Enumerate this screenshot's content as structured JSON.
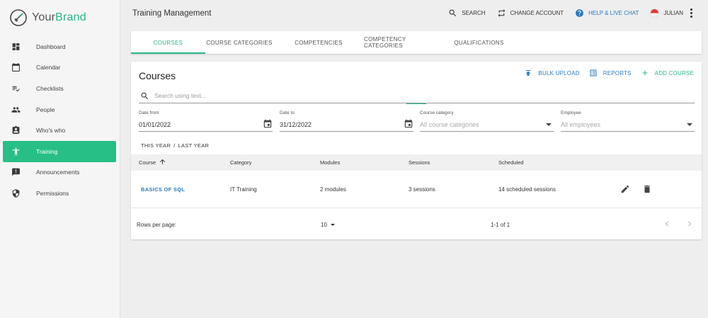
{
  "brand": {
    "name_prefix": "Your",
    "name_suffix": "Brand",
    "accent": "#26b882"
  },
  "sidebar": {
    "items": [
      {
        "label": "Dashboard",
        "icon": "dashboard-icon"
      },
      {
        "label": "Calendar",
        "icon": "calendar-icon"
      },
      {
        "label": "Checklists",
        "icon": "checklist-icon"
      },
      {
        "label": "People",
        "icon": "people-icon"
      },
      {
        "label": "Who's who",
        "icon": "badge-icon"
      },
      {
        "label": "Training",
        "icon": "accessibility-icon",
        "active": true
      },
      {
        "label": "Announcements",
        "icon": "announcement-icon"
      },
      {
        "label": "Permissions",
        "icon": "shield-icon"
      }
    ]
  },
  "header": {
    "title": "Training Management",
    "search_label": "SEARCH",
    "change_account_label": "CHANGE ACCOUNT",
    "help_label": "HELP & LIVE CHAT",
    "user_label": "JULIAN"
  },
  "tabs": [
    {
      "label": "COURSES",
      "active": true
    },
    {
      "label": "COURSE CATEGORIES"
    },
    {
      "label": "COMPETENCIES"
    },
    {
      "label": "COMPETENCY CATEGORIES"
    },
    {
      "label": "QUALIFICATIONS"
    }
  ],
  "courses": {
    "title": "Courses",
    "bulk_upload_label": "BULK UPLOAD",
    "reports_label": "REPORTS",
    "add_course_label": "ADD COURSE",
    "search_placeholder": "Search using text...",
    "filters": {
      "date_from_label": "Date from",
      "date_from_value": "01/01/2022",
      "date_to_label": "Date to",
      "date_to_value": "31/12/2022",
      "category_label": "Course category",
      "category_value": "All course categories",
      "employee_label": "Employee",
      "employee_value": "All employees"
    },
    "quick_this_year": "THIS YEAR",
    "quick_separator": "/",
    "quick_last_year": "LAST YEAR",
    "columns": [
      "Course",
      "Category",
      "Modules",
      "Sessions",
      "Scheduled"
    ],
    "rows": [
      {
        "course": "BASICS OF SQL",
        "category": "IT Training",
        "modules": "2 modules",
        "sessions": "3 sessions",
        "scheduled": "14 scheduled sessions"
      }
    ],
    "pagination": {
      "rows_per_page_label": "Rows per page:",
      "rows_per_page_value": "10",
      "range": "1-1 of 1"
    }
  }
}
